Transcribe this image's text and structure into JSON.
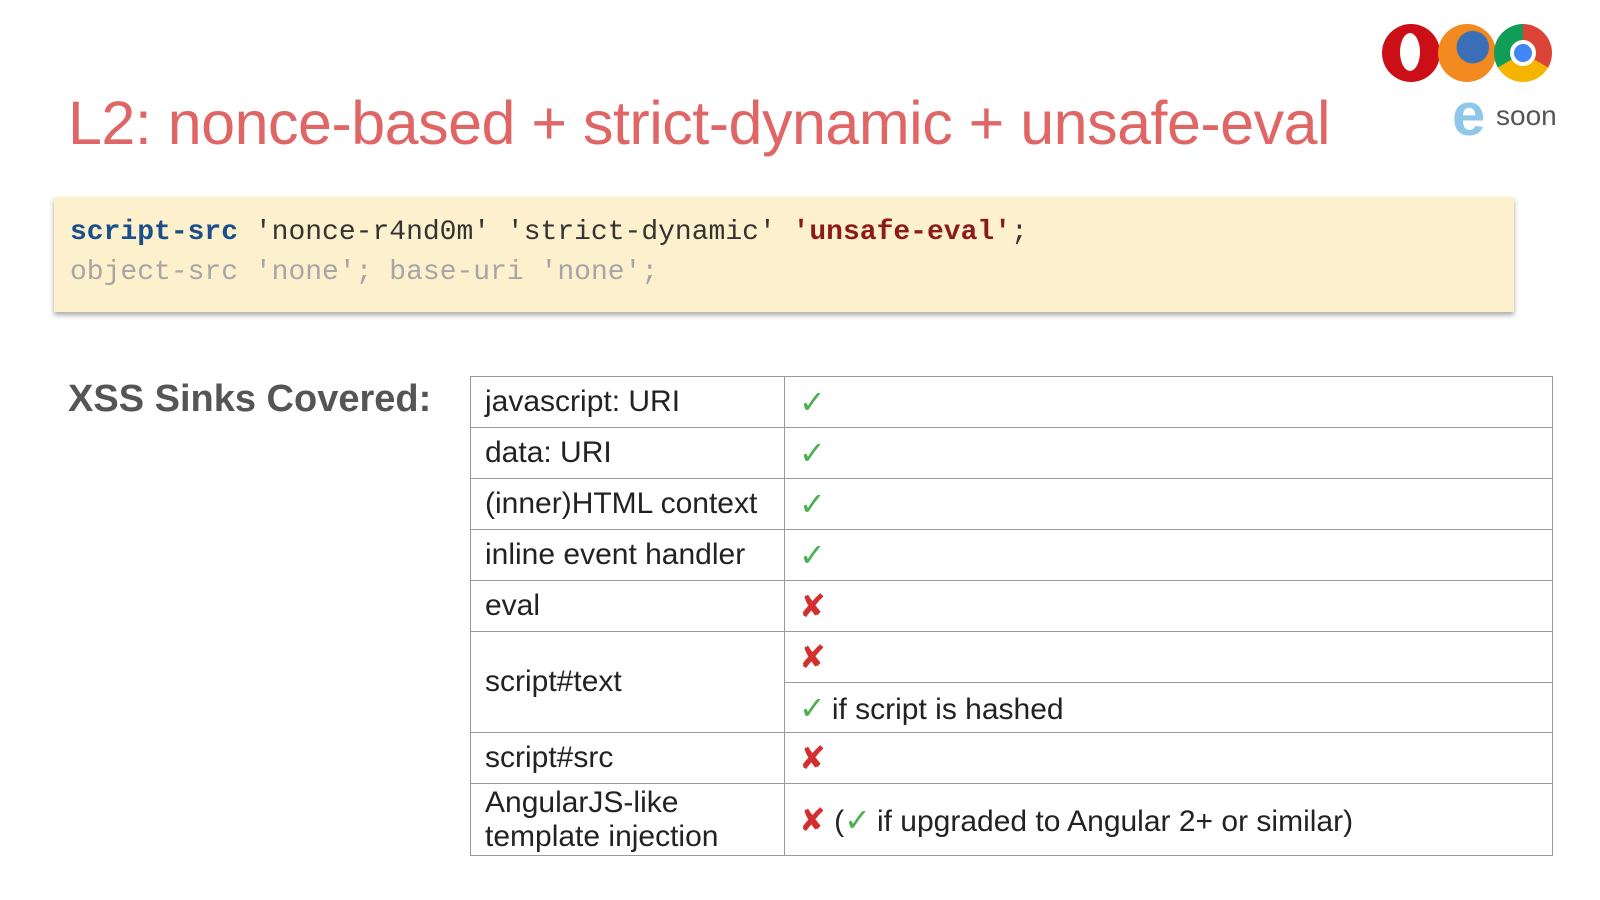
{
  "title": "L2: nonce-based + strict-dynamic + unsafe-eval",
  "browsers": {
    "icons": [
      "opera-icon",
      "firefox-icon",
      "chrome-icon",
      "edge-icon"
    ],
    "edge_letter": "e",
    "edge_note": "soon"
  },
  "code": {
    "line1": {
      "directive": "script-src",
      "nonce": "'nonce-r4nd0m'",
      "strict": "'strict-dynamic'",
      "unsafe_eval": "'unsafe-eval'",
      "end": ";"
    },
    "line2": {
      "object_directive": "object-src",
      "object_value": "'none'",
      "sep": ";",
      "base_directive": "base-uri",
      "base_value": "'none'",
      "end": ";"
    }
  },
  "sinks_heading": "XSS Sinks Covered:",
  "marks": {
    "ok": "✓",
    "no": "✘"
  },
  "colors": {
    "ok": "#4caf50",
    "no": "#d32f2f",
    "title": "#e06666",
    "codebox": "#fdf0cc"
  },
  "rows": [
    {
      "sink": "javascript: URI",
      "status": "covered"
    },
    {
      "sink": "data: URI",
      "status": "covered"
    },
    {
      "sink": "(inner)HTML context",
      "status": "covered"
    },
    {
      "sink": "inline event handler",
      "status": "covered"
    },
    {
      "sink": "eval",
      "status": "not covered"
    },
    {
      "sink": "script#text",
      "status": "not covered",
      "substatus_note": "if script is hashed"
    },
    {
      "sink": "script#src",
      "status": "not covered"
    },
    {
      "sink_line1": "AngularJS-like",
      "sink_line2": "template injection",
      "status": "not covered",
      "note_open": "(",
      "note": "if upgraded to Angular 2+ or similar)"
    }
  ]
}
